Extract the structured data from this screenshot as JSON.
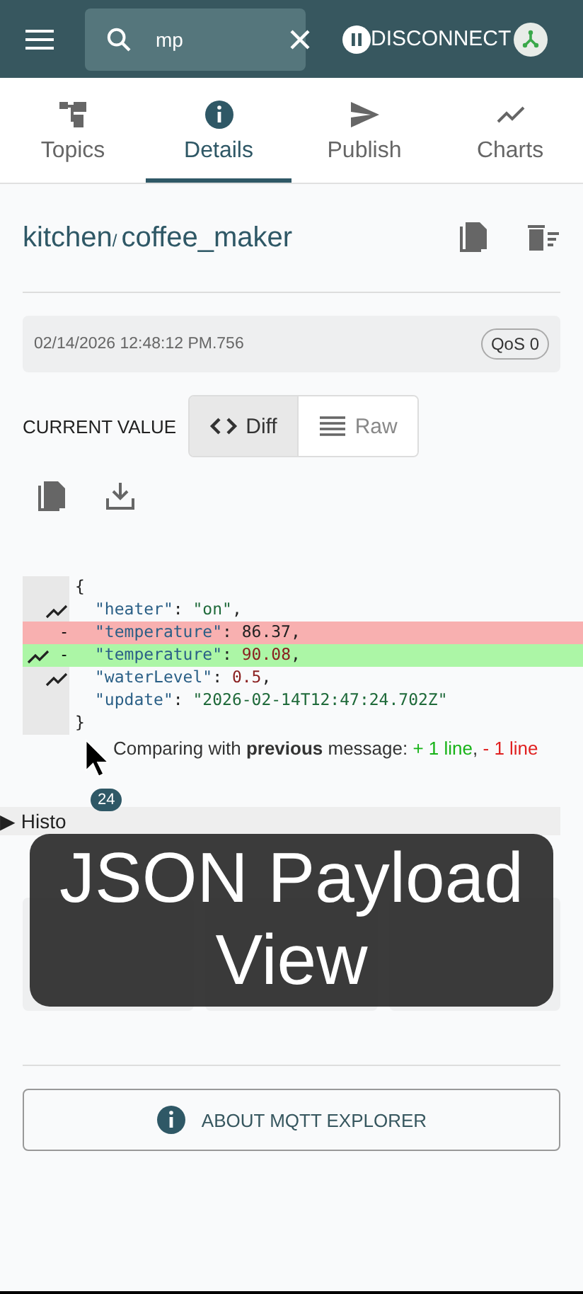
{
  "toolbar": {
    "search": {
      "value": "mp"
    },
    "disconnect_label": "DISCONNECT",
    "paused": true
  },
  "tabs": [
    {
      "label": "Topics",
      "selected": false
    },
    {
      "label": "Details",
      "selected": true
    },
    {
      "label": "Publish",
      "selected": false
    },
    {
      "label": "Charts",
      "selected": false
    }
  ],
  "topic": {
    "segments": [
      {
        "kind": "name",
        "text": "kitchen"
      },
      {
        "kind": "sep",
        "text": "/"
      },
      {
        "kind": "name",
        "text": "coffee_maker"
      }
    ]
  },
  "message": {
    "timestamp": "02/14/2026 12:48:12 PM.756",
    "qos": "QoS 0"
  },
  "value": {
    "label": "CURRENT VALUE",
    "modes": [
      {
        "label": "Diff",
        "selected": true
      },
      {
        "label": "Raw",
        "selected": false
      }
    ]
  },
  "diff": {
    "open": "{",
    "close": "}",
    "entries": [
      {
        "kind": "context",
        "chart": true,
        "parts": [
          {
            "kind": "key",
            "s": "\"heater\""
          },
          {
            "kind": "punct",
            "s": ": "
          },
          {
            "kind": "string",
            "s": "\"on\""
          },
          {
            "kind": "punct",
            "s": ","
          }
        ]
      },
      {
        "kind": "removed",
        "chart": false,
        "marker": "-",
        "parts": [
          {
            "kind": "key",
            "s": "\"temperature\""
          },
          {
            "kind": "punct",
            "s": ": 86.37,"
          }
        ]
      },
      {
        "kind": "added",
        "chart": true,
        "marker": "-",
        "parts": [
          {
            "kind": "key",
            "s": "\"temperature\""
          },
          {
            "kind": "punct",
            "s": ": "
          },
          {
            "kind": "number",
            "s": "90.08"
          },
          {
            "kind": "punct",
            "s": ","
          }
        ]
      },
      {
        "kind": "context",
        "chart": true,
        "parts": [
          {
            "kind": "key",
            "s": "\"waterLevel\""
          },
          {
            "kind": "punct",
            "s": ": "
          },
          {
            "kind": "number",
            "s": "0.5"
          },
          {
            "kind": "punct",
            "s": ","
          }
        ]
      },
      {
        "kind": "context",
        "chart": false,
        "parts": [
          {
            "kind": "key",
            "s": "\"update\""
          },
          {
            "kind": "punct",
            "s": ": "
          },
          {
            "kind": "string",
            "s": "\"2026-02-14T12:47:24.702Z\""
          }
        ]
      }
    ],
    "summary": "Comparing with **previous** message: ",
    "added": "+ 1 line",
    "separator": ", ",
    "removed": "- 1 line"
  },
  "history": {
    "label": "▶ Histo",
    "count": "24"
  },
  "about_button": "ABOUT MQTT EXPLORER",
  "caption": "JSON Payload View"
}
